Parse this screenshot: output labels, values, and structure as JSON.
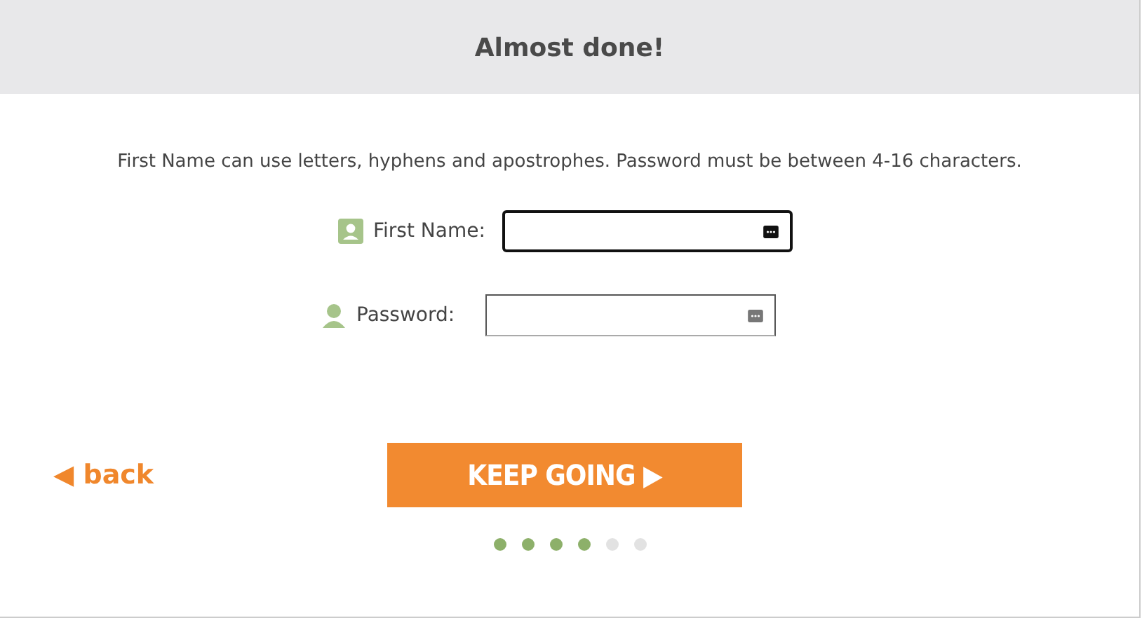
{
  "header": {
    "title": "Almost done!"
  },
  "instructions": "First Name can use letters, hyphens and apostrophes. Password must be between 4-16 characters.",
  "fields": [
    {
      "label": "First Name:",
      "focused": true,
      "kind": "name"
    },
    {
      "label": "Password:",
      "focused": false,
      "kind": "password"
    }
  ],
  "back": {
    "arrow": "◀",
    "label": "back"
  },
  "continue": {
    "label": "KEEP GOING",
    "arrow": "▶"
  },
  "steps": [
    {
      "done": true
    },
    {
      "done": true
    },
    {
      "done": true
    },
    {
      "done": true
    },
    {
      "done": false
    },
    {
      "done": false
    }
  ]
}
